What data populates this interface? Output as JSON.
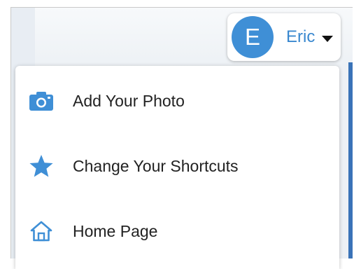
{
  "user": {
    "initial": "E",
    "name": "Eric"
  },
  "menu": {
    "items": [
      {
        "label": "Add Your Photo",
        "icon": "camera-icon"
      },
      {
        "label": "Change Your Shortcuts",
        "icon": "star-icon"
      },
      {
        "label": "Home Page",
        "icon": "home-icon"
      }
    ]
  },
  "colors": {
    "accent": "#3f8fd6",
    "name_text": "#3a88cf",
    "side_bar": "#3a73b8"
  }
}
